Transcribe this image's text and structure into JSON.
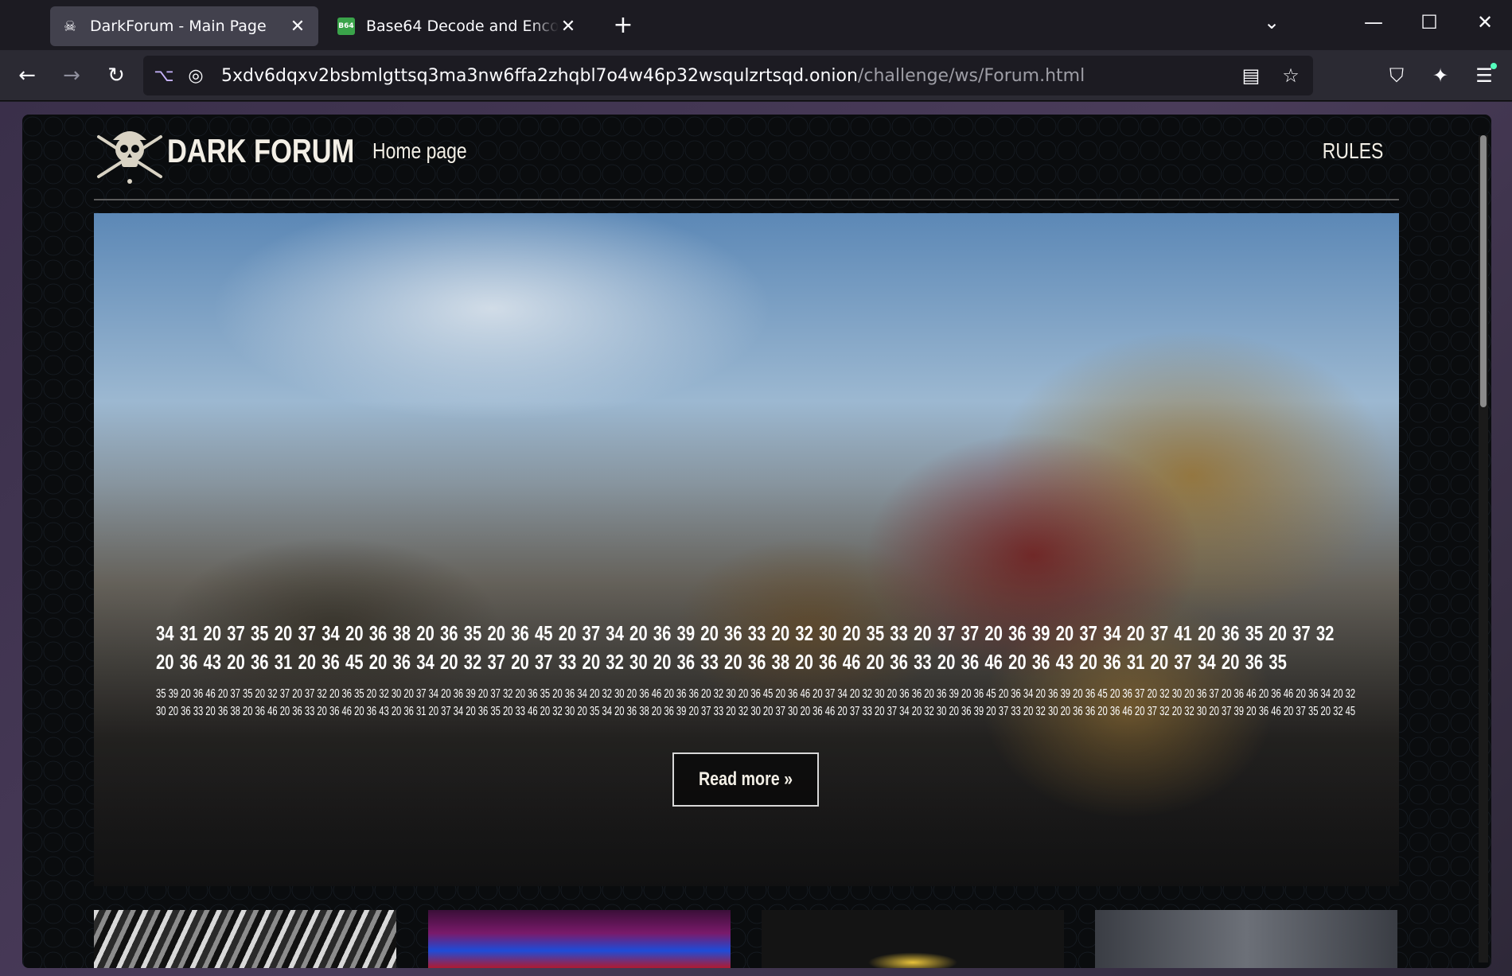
{
  "browser": {
    "tabs": [
      {
        "title": "DarkForum - Main Page",
        "favicon": "pirate-skull-icon",
        "active": true
      },
      {
        "title": "Base64 Decode and Encode - Online",
        "favicon": "b64-icon",
        "favicon_text": "B64",
        "active": false
      }
    ],
    "url_domain": "5xdv6dqxv2bsbmlgttsq3ma3nw6ffa2zhqbl7o4w46p32wsqulzrtsqd.onion",
    "url_path": "/challenge/ws/Forum.html"
  },
  "site": {
    "brand": "DARK FORUM",
    "nav_home": "Home page",
    "nav_rules": "RULES",
    "hero_big": "34 31 20 37 35 20 37 34 20 36 38 20 36 35 20 36 45 20 37 34 20 36 39 20 36 33 20 32 30 20 35 33 20 37 37 20 36 39 20 37 34 20 37 41 20 36 35 20 37 32 20 36 43 20 36 31 20 36 45 20 36 34 20 32 37 20 37 33 20 32 30 20 36 33 20 36 38 20 36 46 20 36 33 20 36 46 20 36 43 20 36 31 20 37 34 20 36 35",
    "hero_small": "35 39 20 36 46 20 37 35 20 32 37 20 37 32 20 36 35 20 32 30 20 37 34 20 36 39 20 37 32 20 36 35 20 36 34 20 32 30 20 36 46 20 36 36 20 32 30 20 36 45 20 36 46 20 37 34 20 32 30 20 36 36 20 36 39 20 36 45 20 36 34 20 36 39 20 36 45 20 36 37 20 32 30 20 36 37 20 36 46 20 36 46 20 36 34 20 32 30 20 36 33 20 36 38 20 36 46 20 36 33 20 36 46 20 36 43 20 36 31 20 37 34 20 36 35 20 33 46 20 32 30 20 35 34 20 36 38 20 36 39 20 37 33 20 32 30 20 37 30 20 36 46 20 37 33 20 37 34 20 32 30 20 36 39 20 37 33 20 32 30 20 36 36 20 36 46 20 37 32 20 32 30 20 37 39 20 36 46 20 37 35 20 32 45",
    "read_more": "Read more »"
  }
}
